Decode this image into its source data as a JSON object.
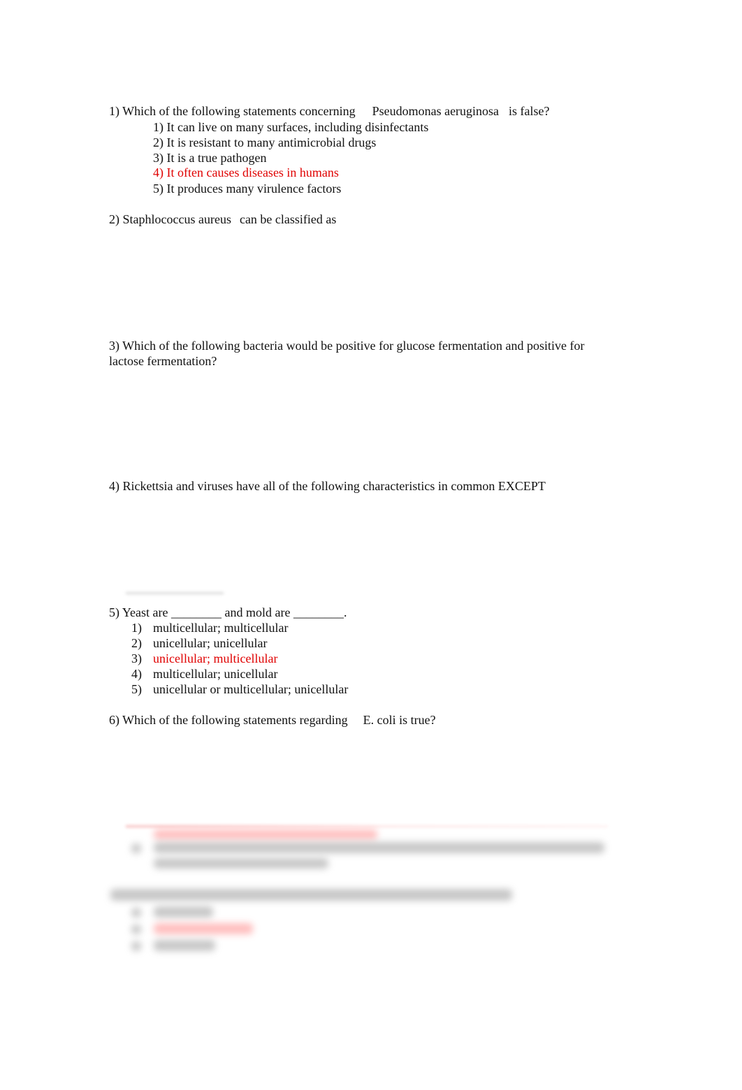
{
  "questions": {
    "q1": {
      "prefix": "1) Which of the following statements concerning",
      "organism": "Pseudomonas aeruginosa",
      "suffix": "is false?",
      "options": [
        {
          "label": "1) It can live on many surfaces, including disinfectants",
          "highlighted": false
        },
        {
          "label": "2) It is resistant to many antimicrobial drugs",
          "highlighted": false
        },
        {
          "label": "3) It is a true pathogen",
          "highlighted": false
        },
        {
          "label": "4) It often causes diseases in humans",
          "highlighted": true
        },
        {
          "label": "5) It produces many virulence factors",
          "highlighted": false
        }
      ]
    },
    "q2": {
      "prefix": "2)",
      "organism": "Staphlococcus aureus",
      "suffix": "can be classified as"
    },
    "q3": {
      "text": "3) Which of the following bacteria would be positive for glucose fermentation and positive for lactose fermentation?"
    },
    "q4": {
      "text": "4) Rickettsia and viruses have all of the following characteristics in common EXCEPT"
    },
    "q5": {
      "text": "5) Yeast are ________ and mold are ________.",
      "options": [
        {
          "num": "1)",
          "label": "multicellular; multicellular",
          "highlighted": false
        },
        {
          "num": "2)",
          "label": "unicellular; unicellular",
          "highlighted": false
        },
        {
          "num": "3)",
          "label": "unicellular; multicellular",
          "highlighted": true
        },
        {
          "num": "4)",
          "label": "multicellular; unicellular",
          "highlighted": false
        },
        {
          "num": "5)",
          "label": "unicellular or multicellular; unicellular",
          "highlighted": false
        }
      ]
    },
    "q6": {
      "prefix": "6) Which of the following statements regarding",
      "organism": "E. coli",
      "suffix": "is true?"
    }
  },
  "colors": {
    "text": "#111111",
    "answer_highlight": "#e00000"
  }
}
